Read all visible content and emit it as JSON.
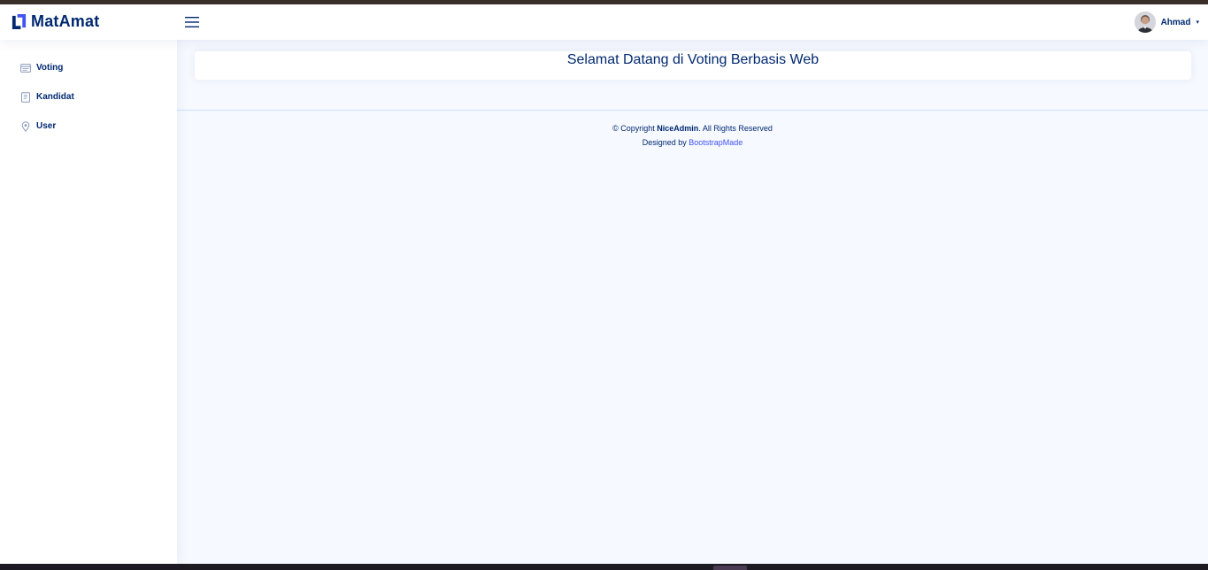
{
  "brand": {
    "name": "MatAmat"
  },
  "header": {
    "menu_icon": "hamburger-icon",
    "profile": {
      "name": "Ahmad",
      "caret": "▾"
    }
  },
  "sidebar": {
    "items": [
      {
        "label": "Voting",
        "icon": "layout-icon"
      },
      {
        "label": "Kandidat",
        "icon": "journal-icon"
      },
      {
        "label": "User",
        "icon": "location-pin-icon"
      }
    ]
  },
  "main": {
    "welcome_title": "Selamat Datang di Voting Berbasis Web"
  },
  "footer": {
    "copyright_prefix": "© Copyright ",
    "copyright_brand": "NiceAdmin",
    "copyright_suffix": ". All Rights Reserved",
    "designed_prefix": "Designed by ",
    "designed_link": "BootstrapMade"
  },
  "colors": {
    "primary_text": "#012970",
    "accent": "#4154f1",
    "background": "#f6f9ff"
  }
}
